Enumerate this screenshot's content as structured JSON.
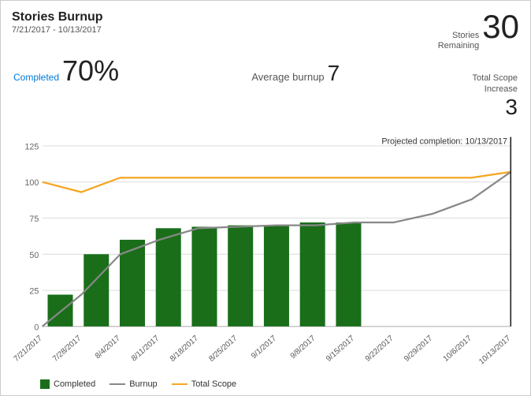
{
  "header": {
    "title": "Stories Burnup",
    "date_range": "7/21/2017 - 10/13/2017",
    "stories_remaining_label": "Stories\nRemaining",
    "stories_remaining_number": "30",
    "completed_label": "Completed",
    "completed_value": "70%",
    "average_burnup_label": "Average burnup",
    "average_burnup_value": "7",
    "total_scope_label": "Total Scope\nIncrease",
    "total_scope_value": "3"
  },
  "chart": {
    "projected_label": "Projected completion: 10/13/2017",
    "y_axis_max": 125,
    "y_ticks": [
      0,
      25,
      50,
      75,
      100,
      125
    ],
    "x_labels": [
      "7/21/2017",
      "7/28/2017",
      "8/4/2017",
      "8/11/2017",
      "8/18/2017",
      "8/25/2017",
      "9/1/2017",
      "9/8/2017",
      "9/15/2017",
      "9/22/2017",
      "9/29/2017",
      "10/6/2017",
      "10/13/2017"
    ],
    "bar_values": [
      22,
      50,
      60,
      68,
      69,
      70,
      70,
      72,
      72,
      0,
      0,
      0,
      0
    ],
    "burnup_line": [
      0,
      22,
      50,
      60,
      68,
      69,
      70,
      70,
      72,
      72,
      78,
      88,
      100,
      107
    ],
    "total_scope_line": [
      100,
      93,
      103,
      103,
      103,
      103,
      103,
      103,
      103,
      103,
      103,
      103,
      103,
      107
    ]
  },
  "legend": {
    "completed_label": "Completed",
    "burnup_label": "Burnup",
    "total_scope_label": "Total Scope"
  }
}
